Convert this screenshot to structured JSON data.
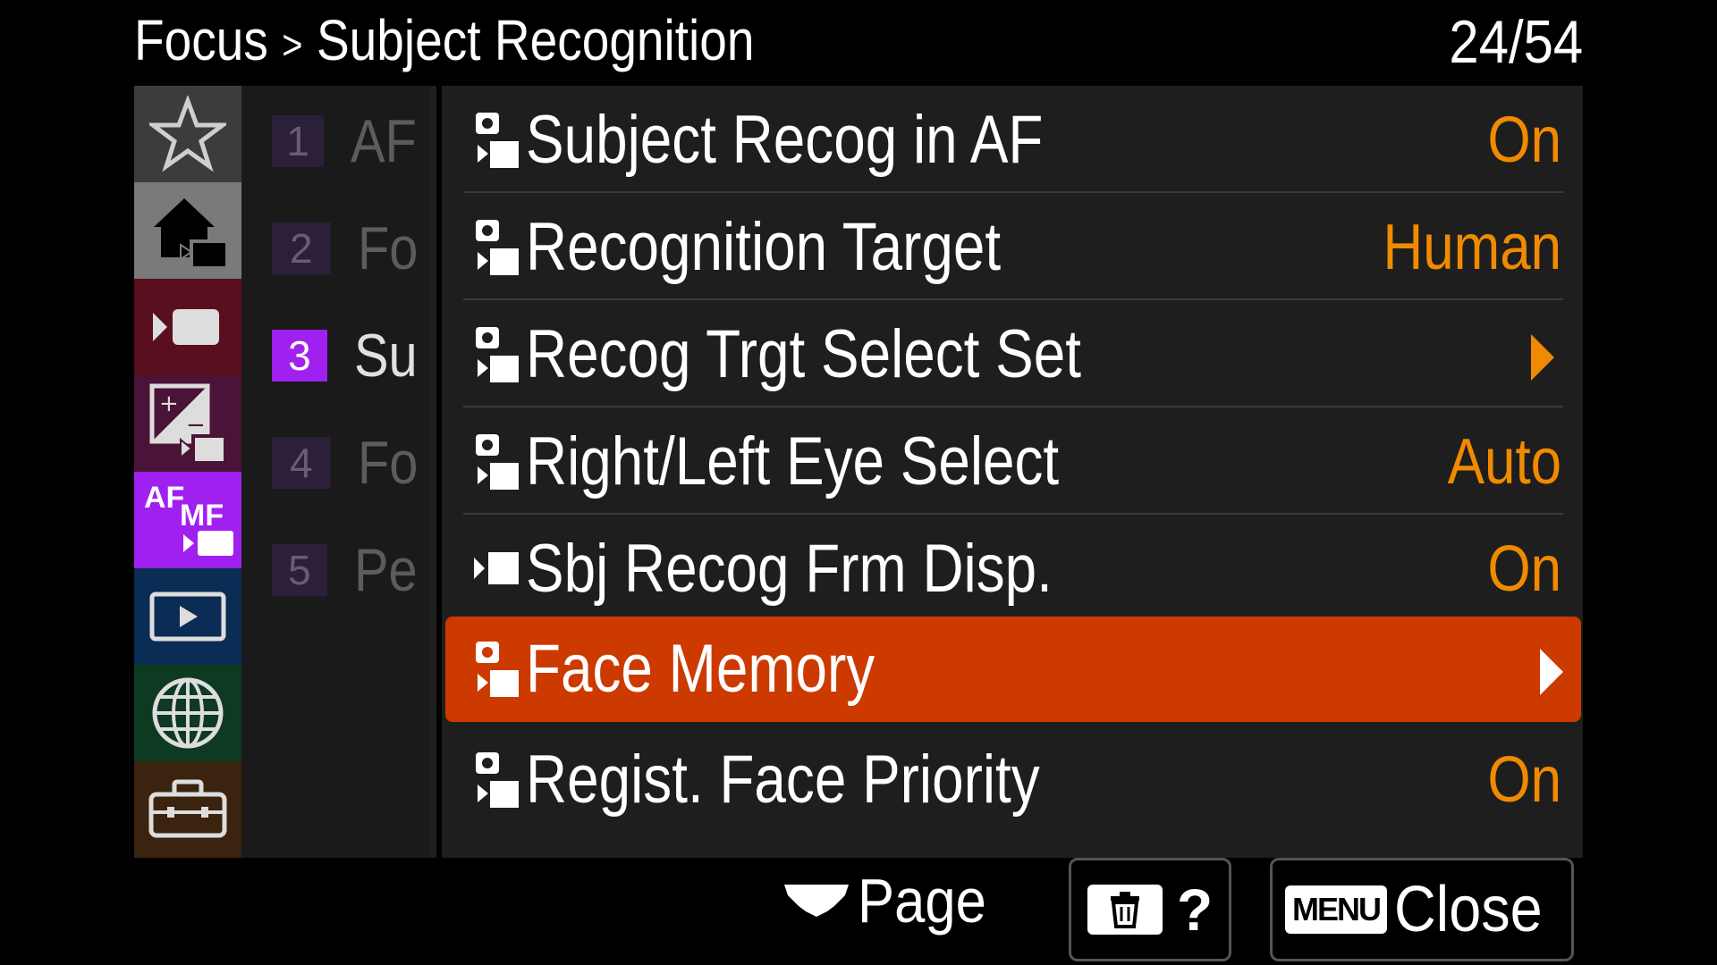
{
  "header": {
    "section": "Focus",
    "separator": ">",
    "title": "Subject Recognition",
    "page_counter": "24/54"
  },
  "tabs": [
    {
      "name": "favorites",
      "icon": "star-icon",
      "color": "#3c3c3c"
    },
    {
      "name": "main",
      "icon": "home-camera-icon",
      "color": "#7a7a7a",
      "selected": true
    },
    {
      "name": "shooting",
      "icon": "camera-record-icon",
      "color": "#5a0f1e"
    },
    {
      "name": "exposure-color",
      "icon": "exposure-icon",
      "color": "#4a1438"
    },
    {
      "name": "focus",
      "icon": "af-mf-icon",
      "color": "#a020f0",
      "label_af": "AF",
      "label_mf": "MF"
    },
    {
      "name": "playback",
      "icon": "playback-icon",
      "color": "#0a2c55"
    },
    {
      "name": "network",
      "icon": "globe-icon",
      "color": "#0e3a22"
    },
    {
      "name": "setup",
      "icon": "toolbox-icon",
      "color": "#3a2410"
    }
  ],
  "pages": [
    {
      "num": "1",
      "label": "AF"
    },
    {
      "num": "2",
      "label": "Fo"
    },
    {
      "num": "3",
      "label": "Su",
      "active": true
    },
    {
      "num": "4",
      "label": "Fo"
    },
    {
      "num": "5",
      "label": "Pe"
    }
  ],
  "menu": [
    {
      "label": "Subject Recog in AF",
      "value": "On",
      "icon": "photo-movie-icon"
    },
    {
      "label": "Recognition Target",
      "value": "Human",
      "icon": "photo-movie-icon"
    },
    {
      "label": "Recog Trgt Select Set",
      "value": "",
      "arrow": true,
      "icon": "photo-movie-icon"
    },
    {
      "label": "Right/Left Eye Select",
      "value": "Auto",
      "icon": "photo-movie-icon"
    },
    {
      "label": "Sbj Recog Frm Disp.",
      "value": "On",
      "icon": "movie-icon"
    },
    {
      "label": "Face Memory",
      "value": "",
      "arrow": true,
      "selected": true,
      "icon": "photo-movie-icon"
    },
    {
      "label": "Regist. Face Priority",
      "value": "On",
      "icon": "photo-movie-icon"
    }
  ],
  "footer": {
    "page_label": "Page",
    "help_label": "?",
    "menu_key": "MENU",
    "close_label": "Close"
  },
  "colors": {
    "accent": "#cc3a00",
    "value": "#f08a00",
    "page_active": "#a020f0"
  }
}
